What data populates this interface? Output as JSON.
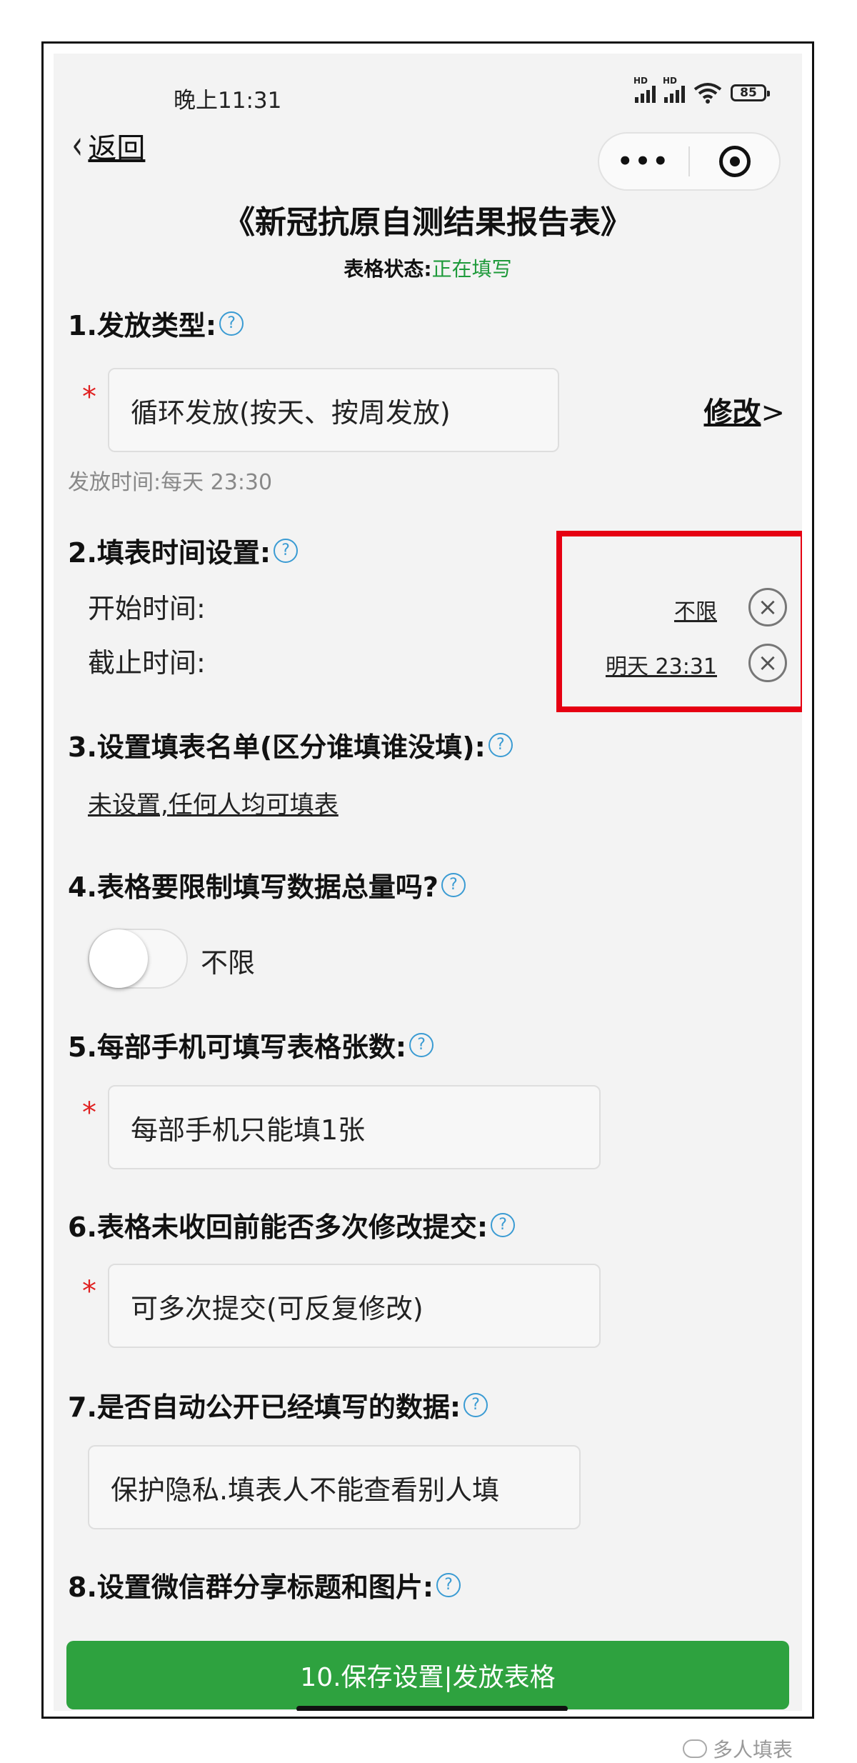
{
  "status_bar": {
    "time": "晚上11:31",
    "battery": "85",
    "signal_label": "HD"
  },
  "nav": {
    "back_label": "返回"
  },
  "header": {
    "title": "《新冠抗原自测结果报告表》",
    "status_label": "表格状态:",
    "status_value": "正在填写",
    "status_color": "#1e9a3a"
  },
  "help_glyph": "?",
  "required_mark": "*",
  "sections": {
    "s1": {
      "title": "1.发放类型:",
      "value": "循环发放(按天、按周发放)",
      "modify_label": "修改",
      "modify_arrow": ">",
      "note": "发放时间:每天 23:30"
    },
    "s2": {
      "title": "2.填表时间设置:",
      "start_label": "开始时间:",
      "start_value": "不限",
      "end_label": "截止时间:",
      "end_value": "明天 23:31",
      "clear_glyph": "×"
    },
    "s3": {
      "title": "3.设置填表名单(区分谁填谁没填):",
      "link": "未设置,任何人均可填表"
    },
    "s4": {
      "title": "4.表格要限制填写数据总量吗?",
      "toggle_label": "不限",
      "toggle_on": false
    },
    "s5": {
      "title": "5.每部手机可填写表格张数:",
      "value": "每部手机只能填1张"
    },
    "s6": {
      "title": "6.表格未收回前能否多次修改提交:",
      "value": "可多次提交(可反复修改)"
    },
    "s7": {
      "title": "7.是否自动公开已经填写的数据:",
      "value": "保护隐私.填表人不能查看别人填"
    },
    "s8": {
      "title": "8.设置微信群分享标题和图片:"
    }
  },
  "footer": {
    "save_button": "10.保存设置|发放表格"
  },
  "watermark": {
    "text": "多人填表"
  },
  "colors": {
    "accent_green": "#2ea23f",
    "help_blue": "#3a9bd3",
    "highlight_red": "#e60012",
    "required_red": "#e02020"
  }
}
